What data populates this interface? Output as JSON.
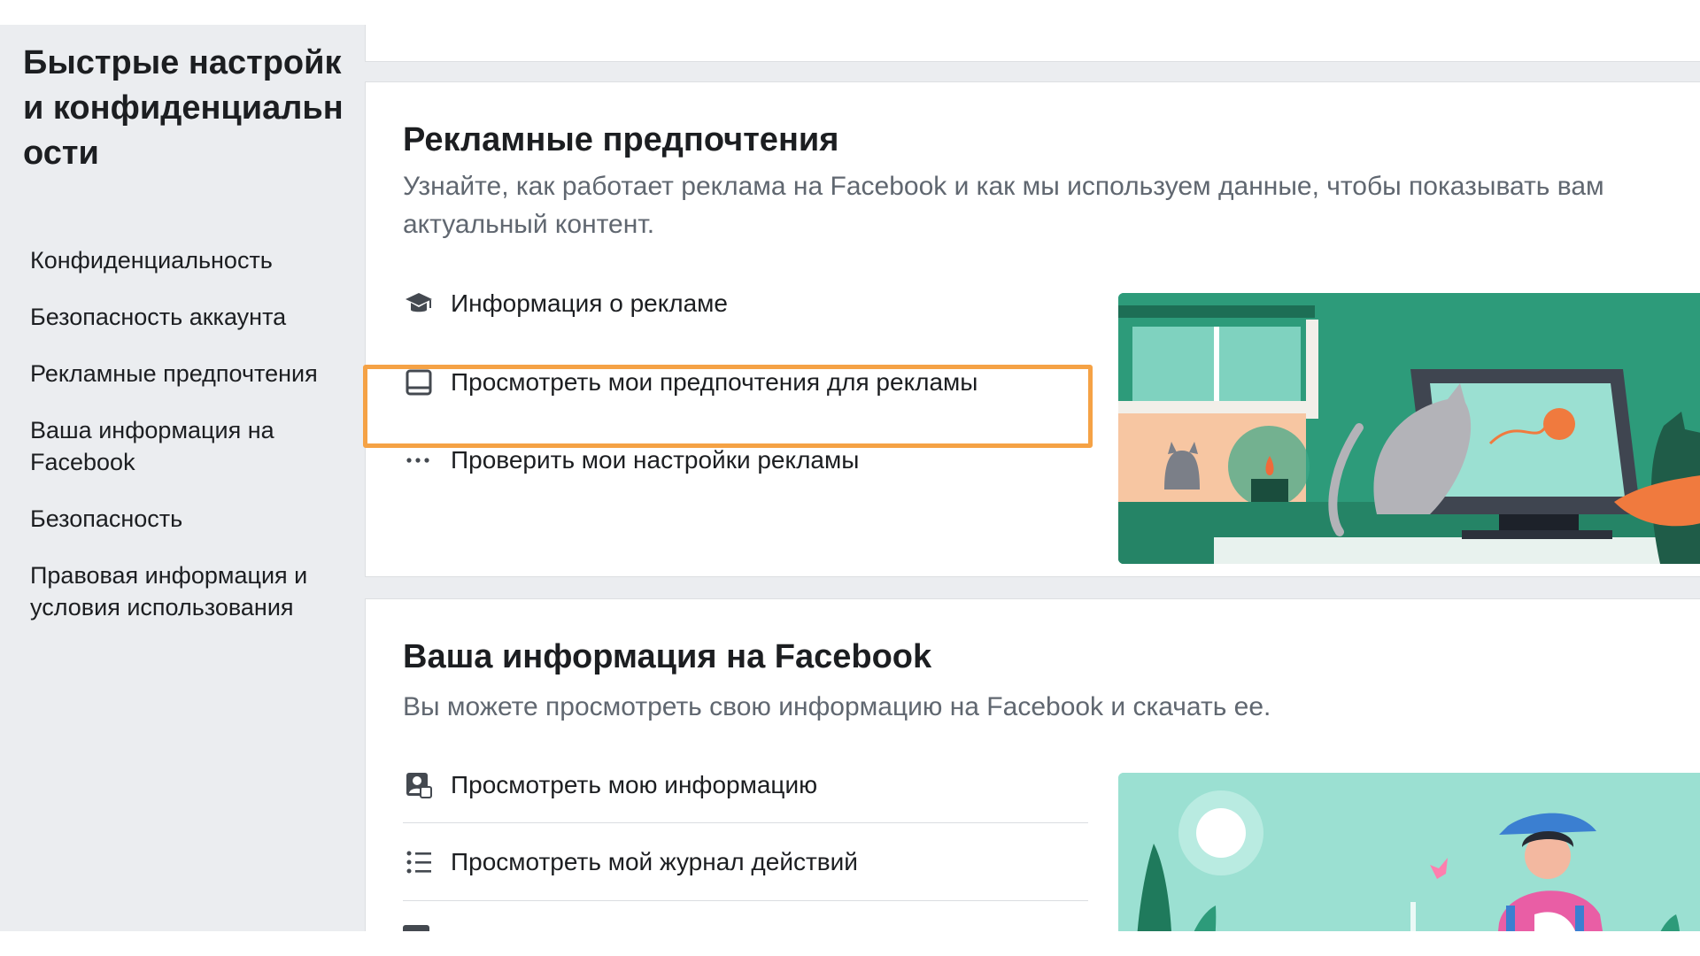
{
  "sidebar": {
    "title": "Быстрые настройки конфиденциальности",
    "items": [
      {
        "label": "Конфиденциальность"
      },
      {
        "label": "Безопасность аккаунта"
      },
      {
        "label": "Рекламные предпочтения"
      },
      {
        "label": "Ваша информация на Facebook"
      },
      {
        "label": "Безопасность"
      },
      {
        "label": "Правовая информация и условия использования"
      }
    ]
  },
  "ads_card": {
    "title": "Рекламные предпочтения",
    "description": "Узнайте, как работает реклама на Facebook и как мы используем данные, чтобы показывать вам актуальный контент.",
    "actions": [
      {
        "label": "Информация о рекламе",
        "icon": "graduation-cap-icon"
      },
      {
        "label": "Просмотреть мои предпочтения для рекламы",
        "icon": "tablet-icon",
        "highlighted": true
      },
      {
        "label": "Проверить мои настройки рекламы",
        "icon": "more-dots-icon"
      }
    ],
    "illustration": "cat-at-computer-illustration"
  },
  "info_card": {
    "title": "Ваша информация на Facebook",
    "description": "Вы можете просмотреть свою информацию на Facebook и скачать ее.",
    "actions": [
      {
        "label": "Просмотреть мою информацию",
        "icon": "profile-card-icon"
      },
      {
        "label": "Просмотреть мой журнал действий",
        "icon": "list-icon"
      }
    ],
    "illustration": "person-with-butterfly-illustration"
  },
  "colors": {
    "highlight": "#f5a245",
    "background": "#ebedf0",
    "illustration_green": "#2d9b7a",
    "illustration_mint": "#9be0d2"
  }
}
